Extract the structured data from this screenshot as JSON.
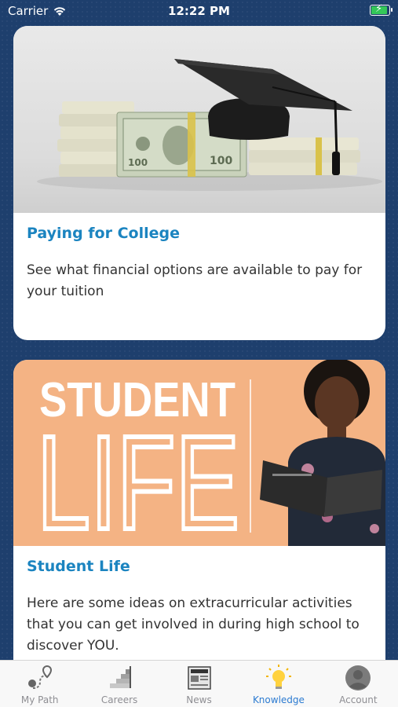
{
  "status_bar": {
    "carrier": "Carrier",
    "time": "12:22 PM"
  },
  "cards": [
    {
      "title": "Paying for College",
      "description": "See what financial options are available to pay for your tuition",
      "image": "graduation-cap-on-money-stacks"
    },
    {
      "title": "Student Life",
      "description": "Here are some ideas on extracurricular activities that you can get involved in during high school to discover YOU.",
      "banner_line1": "STUDENT",
      "banner_line2": "LIFE",
      "image": "student-reading-book"
    }
  ],
  "tabs": [
    {
      "label": "My Path",
      "icon": "map-route-icon",
      "active": false
    },
    {
      "label": "Careers",
      "icon": "stairs-icon",
      "active": false
    },
    {
      "label": "News",
      "icon": "newspaper-icon",
      "active": false
    },
    {
      "label": "Knowledge",
      "icon": "lightbulb-icon",
      "active": true
    },
    {
      "label": "Account",
      "icon": "user-avatar-icon",
      "active": false
    }
  ],
  "colors": {
    "background": "#1e3f6d",
    "title_blue": "#1b84c0",
    "active_tab": "#2c7bd1",
    "inactive_tab": "#8e8e93",
    "banner_orange": "#f4b384"
  }
}
